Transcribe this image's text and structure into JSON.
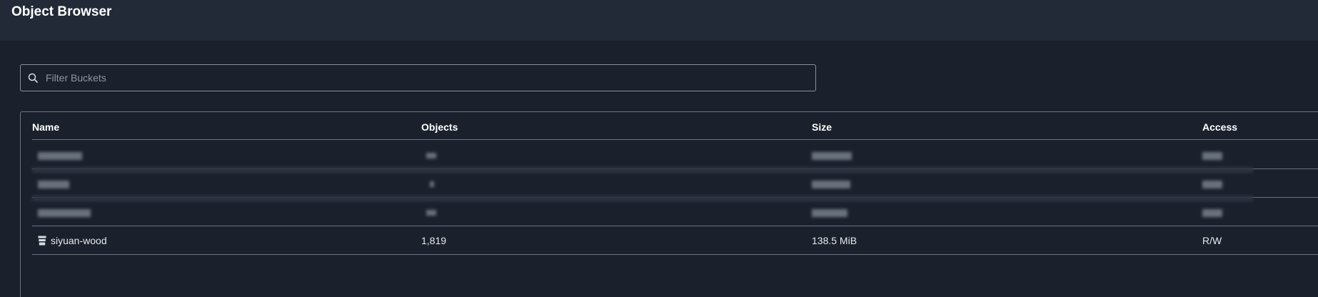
{
  "header": {
    "title": "Object Browser"
  },
  "search": {
    "placeholder": "Filter Buckets",
    "value": ""
  },
  "table": {
    "columns": [
      "Name",
      "Objects",
      "Size",
      "Access"
    ],
    "rows": [
      {
        "name": "siyuan-wood",
        "objects": "1,819",
        "size": "138.5 MiB",
        "access": "R/W",
        "icon": "bucket-icon"
      }
    ]
  },
  "colors": {
    "background": "#1b212c",
    "header_bar": "#222a37",
    "border": "#6c7480",
    "text": "#e6e8eb"
  }
}
